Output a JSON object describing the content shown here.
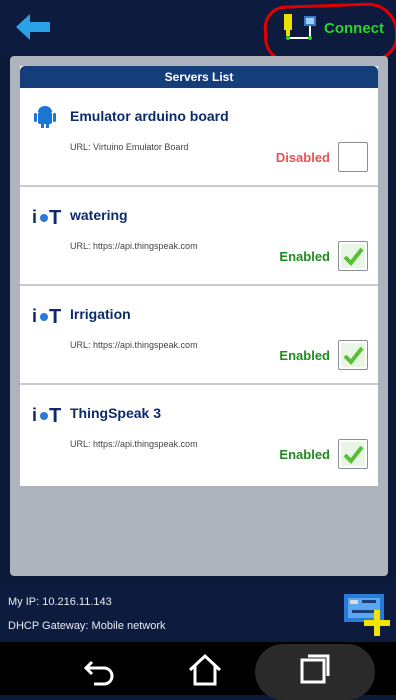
{
  "header": {
    "connect_label": "Connect"
  },
  "list": {
    "title": "Servers List",
    "items": [
      {
        "name": "Emulator arduino board",
        "url": "URL: Virtuino Emulator Board",
        "status": "Disabled",
        "checked": false,
        "icon": "android-icon"
      },
      {
        "name": "watering",
        "url": "URL: https://api.thingspeak.com",
        "status": "Enabled",
        "checked": true,
        "icon": "iot-icon"
      },
      {
        "name": "Irrigation",
        "url": "URL: https://api.thingspeak.com",
        "status": "Enabled",
        "checked": true,
        "icon": "iot-icon"
      },
      {
        "name": "ThingSpeak 3",
        "url": "URL: https://api.thingspeak.com",
        "status": "Enabled",
        "checked": true,
        "icon": "iot-icon"
      }
    ]
  },
  "footer": {
    "ip": "My IP: 10.216.11.143",
    "gateway": "DHCP Gateway: Mobile network"
  },
  "colors": {
    "enabled": "#1f8a1f",
    "disabled": "#e05555",
    "connect": "#2bd42b",
    "header_bg": "#153d7a"
  }
}
